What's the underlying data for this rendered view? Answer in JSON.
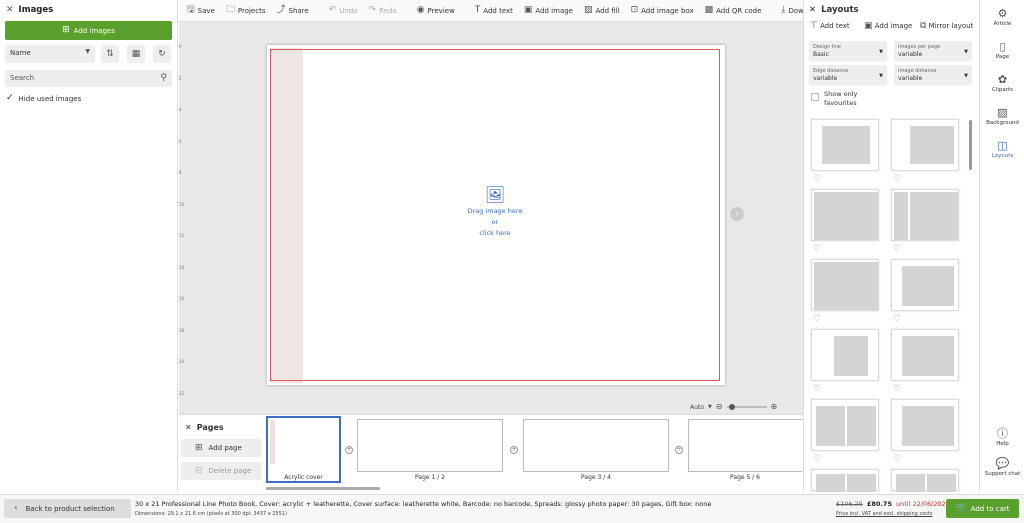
{
  "left_panel": {
    "title": "Images",
    "add_images": "Add images",
    "sort_value": "Name",
    "search_placeholder": "Search",
    "hide_used": "Hide used images"
  },
  "toolbar": {
    "save": "Save",
    "projects": "Projects",
    "share": "Share",
    "undo": "Undo",
    "redo": "Redo",
    "preview": "Preview",
    "add_text": "Add text",
    "add_image": "Add image",
    "add_fill": "Add fill",
    "add_image_box": "Add image box",
    "add_qr": "Add QR code",
    "download": "Download software"
  },
  "canvas": {
    "drop_line1": "Drag image here",
    "drop_line2": "or",
    "drop_line3": "click here",
    "ruler": [
      "0",
      "2",
      "4",
      "6",
      "8",
      "10",
      "12",
      "14",
      "16",
      "18",
      "20",
      "22"
    ]
  },
  "pages": {
    "title": "Pages",
    "add_page": "Add page",
    "delete_page": "Delete page",
    "zoom_mode": "Auto",
    "thumbs": [
      "Acrylic cover",
      "Page 1 / 2",
      "Page 3 / 4",
      "Page 5 / 6"
    ]
  },
  "right_panel": {
    "title": "Layouts",
    "add_text": "Add text",
    "add_image": "Add image",
    "mirror": "Mirror layout",
    "design_line_label": "Design line",
    "design_line_value": "Basic",
    "images_per_page_label": "Images per page",
    "images_per_page_value": "variable",
    "edge_distance_label": "Edge distance",
    "edge_distance_value": "variable",
    "image_distance_label": "Image distance",
    "image_distance_value": "variable",
    "show_favourites": "Show only favourites"
  },
  "side_nav": {
    "article": "Article",
    "page": "Page",
    "cliparts": "Cliparts",
    "background": "Background",
    "layouts": "Layouts",
    "help": "Help",
    "support": "Support chat"
  },
  "bottom": {
    "back": "Back to product selection",
    "product": "30 x 21 Professional Line Photo Book, Cover: acrylic + leatherette, Cover surface: leatherette white, Barcode: no barcode, Spreads: glossy photo paper: 30 pages, Gift box: none",
    "dimensions": "Dimensions: 29.1 x 21.6 cm (pixels at 300 dpi: 3437 x 2551)",
    "old_price": "£106.25",
    "price": "£80.75",
    "until": "until 22/06/2025",
    "price_note": "Price incl. VAT and excl. shipping costs",
    "add_to_cart": "Add to cart"
  },
  "colors": {
    "accent": "#5aa02c",
    "bleed": "#e05560",
    "link": "#3a6fc4"
  }
}
